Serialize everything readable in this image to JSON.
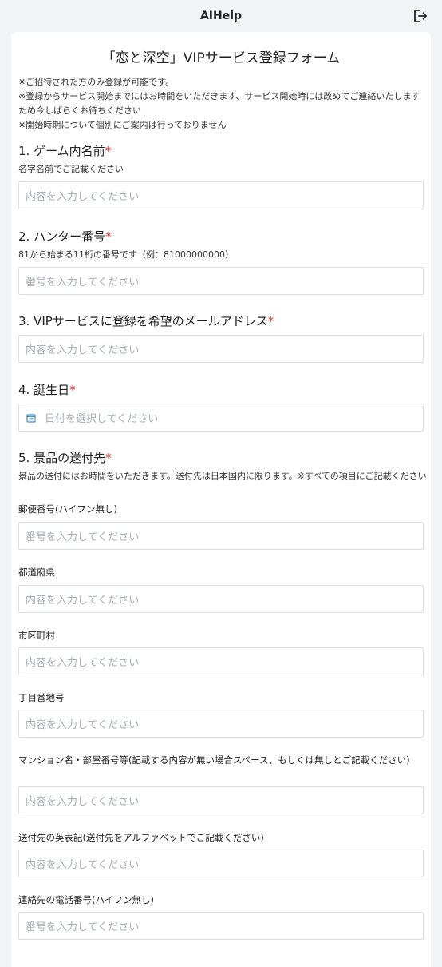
{
  "app": {
    "title": "AIHelp"
  },
  "form": {
    "title": "「恋と深空」VIPサービス登録フォーム",
    "notices": [
      "※ご招待された方のみ登録が可能です。",
      "※登録からサービス開始までにはお時間をいただきます、サービス開始時には改めてご連絡いたしますため今しばらくお待ちください",
      "※開始時期について個別にご案内は行っておりません"
    ],
    "required_mark": "*",
    "q1": {
      "title": "1. ゲーム内名前",
      "desc": "名字名前でご記載ください",
      "placeholder": "内容を入力してください"
    },
    "q2": {
      "title": "2. ハンター番号",
      "desc": "81から始まる11桁の番号です（例：81000000000）",
      "placeholder": "番号を入力してください"
    },
    "q3": {
      "title": "3. VIPサービスに登録を希望のメールアドレス",
      "placeholder": "内容を入力してください"
    },
    "q4": {
      "title": "4. 誕生日",
      "placeholder": "日付を選択してください"
    },
    "q5": {
      "title": "5. 景品の送付先",
      "desc": "景品の送付にはお時間をいただきます。送付先は日本国内に限ります。※すべての項目にご記載ください",
      "fields": [
        {
          "label": "郵便番号(ハイフン無し)",
          "placeholder": "番号を入力してください"
        },
        {
          "label": "都道府県",
          "placeholder": "内容を入力してください"
        },
        {
          "label": "市区町村",
          "placeholder": "内容を入力してください"
        },
        {
          "label": "丁目番地号",
          "placeholder": "内容を入力してください"
        },
        {
          "label": "マンション名・部屋番号等(記載する内容が無い場合スペース、もしくは無しとご記載ください)",
          "placeholder": "内容を入力してください"
        },
        {
          "label": "送付先の英表記(送付先をアルファベットでご記載ください)",
          "placeholder": "内容を入力してください"
        },
        {
          "label": "連絡先の電話番号(ハイフン無し)",
          "placeholder": "番号を入力してください"
        }
      ]
    }
  },
  "colors": {
    "required": "#e0312b",
    "date_icon": "#3d8fd6"
  },
  "icons": {
    "exit": "logout-icon",
    "date": "calendar-icon"
  }
}
